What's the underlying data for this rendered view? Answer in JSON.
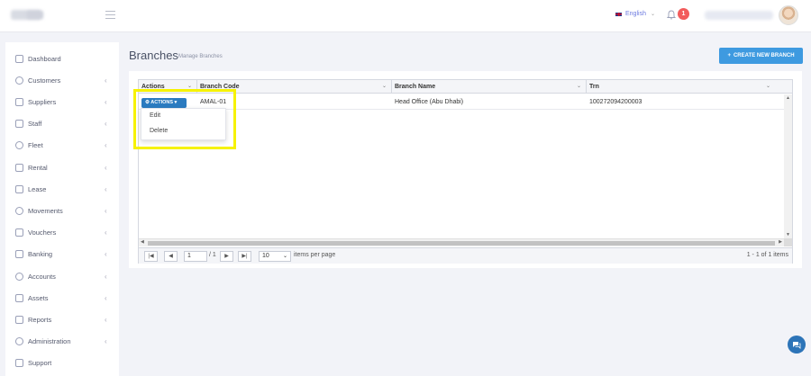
{
  "header": {
    "language": "English",
    "notification_count": "1"
  },
  "sidebar": {
    "items": [
      {
        "label": "Dashboard",
        "icon": "home-icon",
        "chevron": false
      },
      {
        "label": "Customers",
        "icon": "users-icon",
        "chevron": true
      },
      {
        "label": "Suppliers",
        "icon": "layers-icon",
        "chevron": true
      },
      {
        "label": "Staff",
        "icon": "user-icon",
        "chevron": true
      },
      {
        "label": "Fleet",
        "icon": "speedometer-icon",
        "chevron": true
      },
      {
        "label": "Rental",
        "icon": "book-icon",
        "chevron": true
      },
      {
        "label": "Lease",
        "icon": "stack-icon",
        "chevron": true
      },
      {
        "label": "Movements",
        "icon": "flag-icon",
        "chevron": true
      },
      {
        "label": "Vouchers",
        "icon": "document-icon",
        "chevron": true
      },
      {
        "label": "Banking",
        "icon": "calendar-icon",
        "chevron": true
      },
      {
        "label": "Accounts",
        "icon": "ledger-icon",
        "chevron": true
      },
      {
        "label": "Assets",
        "icon": "diamond-icon",
        "chevron": true
      },
      {
        "label": "Reports",
        "icon": "bar-chart-icon",
        "chevron": true
      },
      {
        "label": "Administration",
        "icon": "wrench-icon",
        "chevron": true
      },
      {
        "label": "Support",
        "icon": "lifebuoy-icon",
        "chevron": false
      }
    ]
  },
  "page": {
    "title": "Branches",
    "subtitle": "Manage Branches",
    "create_button": "CREATE NEW BRANCH"
  },
  "grid": {
    "columns": [
      "Actions",
      "Branch Code",
      "Branch Name",
      "Trn"
    ],
    "rows": [
      {
        "code": "AMAL-01",
        "name": "Head Office (Abu Dhabi)",
        "trn": "100272094200003"
      }
    ],
    "actions_button": "ACTIONS",
    "actions_menu": [
      "Edit",
      "Delete"
    ]
  },
  "pager": {
    "current_page": "1",
    "of_text": "/ 1",
    "page_size": "10",
    "page_size_label": "items per page",
    "info": "1 - 1 of 1 items"
  },
  "colors": {
    "primary": "#3e9ae0",
    "actions_button": "#2b7bc0",
    "highlight": "#f6f200",
    "badge": "#f25c5c"
  }
}
